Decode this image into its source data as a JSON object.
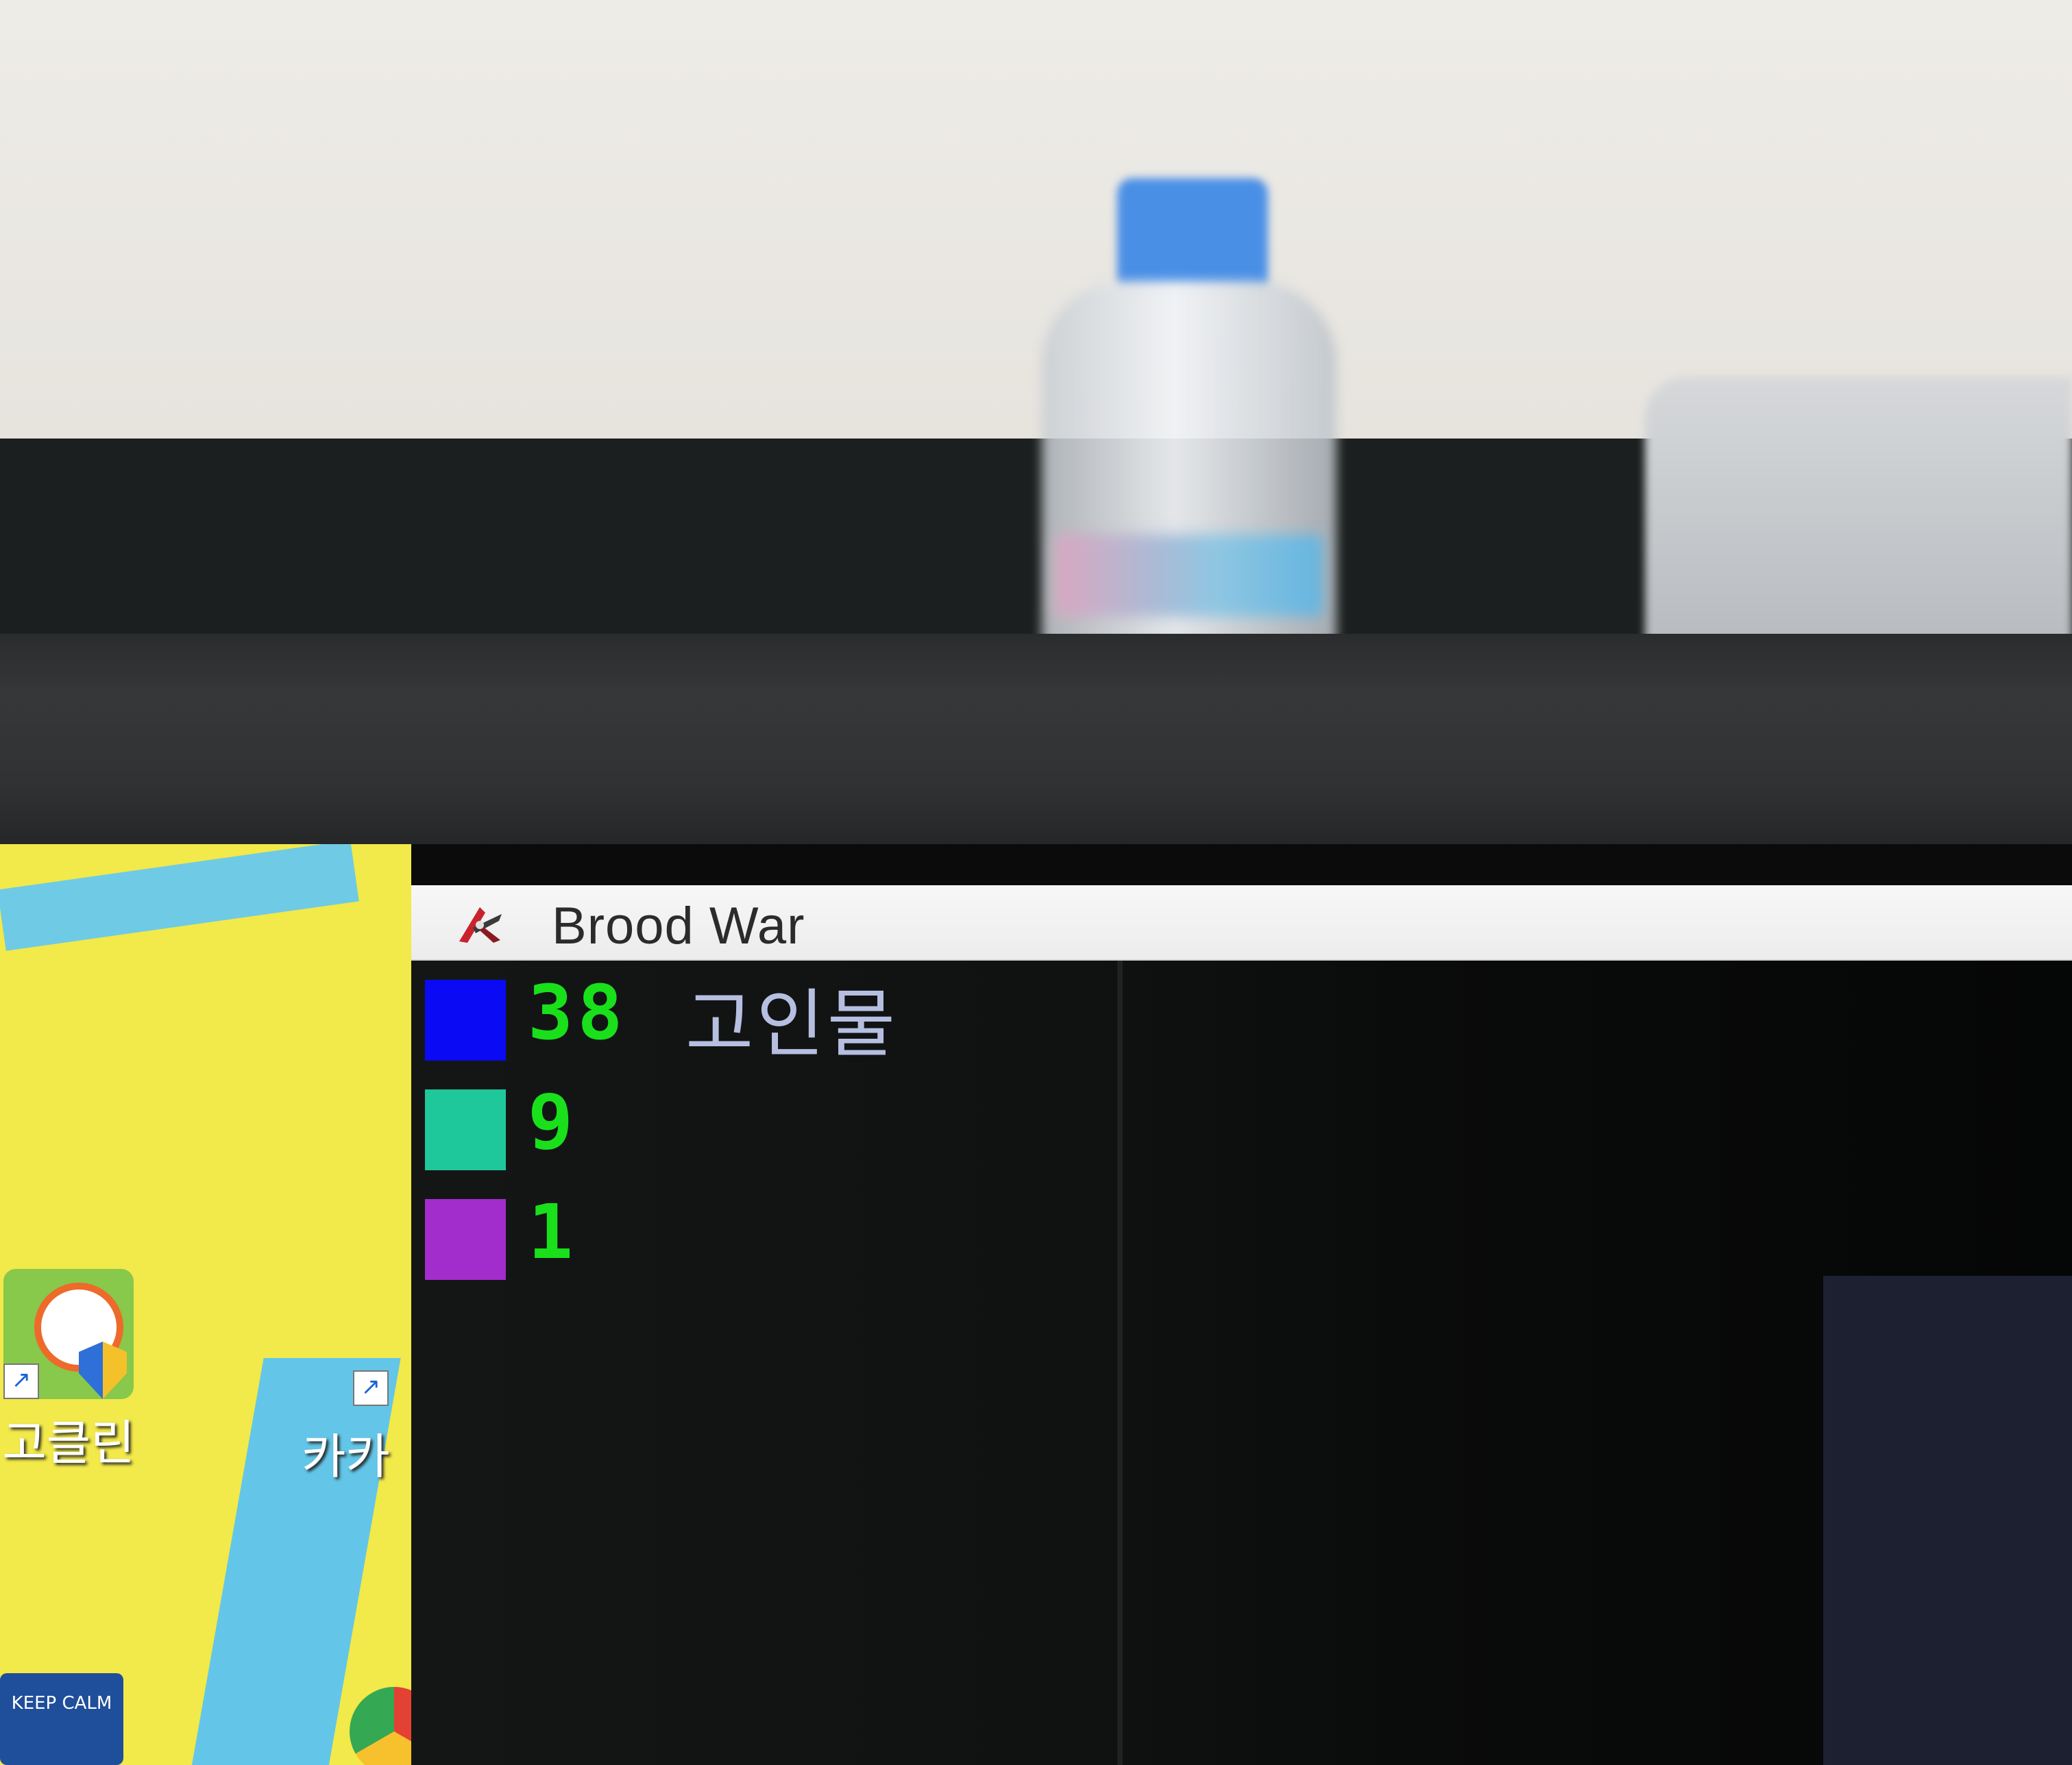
{
  "window": {
    "title": "Brood War",
    "icon": "starcraft-broodwar-icon"
  },
  "scoreboard": [
    {
      "color": "#0a0af4",
      "score": "38",
      "name": "고인물"
    },
    {
      "color": "#1fc89a",
      "score": "9",
      "name": ""
    },
    {
      "color": "#a22dcc",
      "score": "1",
      "name": ""
    }
  ],
  "desktop": {
    "icons": [
      {
        "label": "고클린",
        "icon": "goclean-icon"
      },
      {
        "label": "카카",
        "icon": "kakao-icon"
      }
    ],
    "calm_icon_text": "KEEP CALM"
  },
  "colors": {
    "score_text": "#19e01b",
    "name_text": "#b6bfe0",
    "titlebar": "#f2f2f2"
  }
}
